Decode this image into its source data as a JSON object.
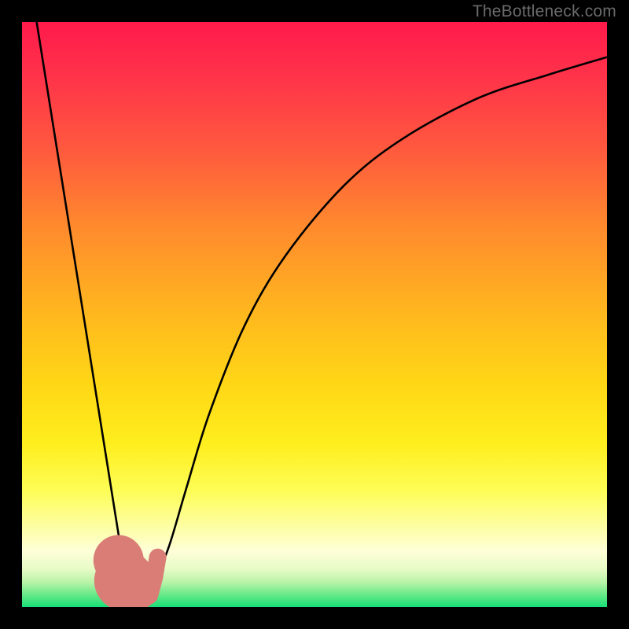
{
  "watermark": "TheBottleneck.com",
  "colors": {
    "black": "#000000",
    "curve": "#000000",
    "dot": "#d97d76"
  },
  "gradient_stops": [
    {
      "offset": 0.0,
      "color": "#ff1a4b"
    },
    {
      "offset": 0.1,
      "color": "#ff3549"
    },
    {
      "offset": 0.22,
      "color": "#ff5a3e"
    },
    {
      "offset": 0.35,
      "color": "#ff8a2d"
    },
    {
      "offset": 0.5,
      "color": "#ffb81e"
    },
    {
      "offset": 0.62,
      "color": "#ffd716"
    },
    {
      "offset": 0.72,
      "color": "#ffee1e"
    },
    {
      "offset": 0.8,
      "color": "#fdfd55"
    },
    {
      "offset": 0.86,
      "color": "#fdfea0"
    },
    {
      "offset": 0.905,
      "color": "#feffd8"
    },
    {
      "offset": 0.935,
      "color": "#e7fbc6"
    },
    {
      "offset": 0.958,
      "color": "#b8f3a8"
    },
    {
      "offset": 0.978,
      "color": "#6be989"
    },
    {
      "offset": 1.0,
      "color": "#17df77"
    }
  ],
  "chart_data": {
    "type": "line",
    "title": "",
    "xlabel": "",
    "ylabel": "",
    "xlim": [
      0,
      100
    ],
    "ylim": [
      0,
      100
    ],
    "grid": false,
    "legend_position": "none",
    "series": [
      {
        "name": "left-descent",
        "values_xy": [
          [
            2.5,
            100
          ],
          [
            18,
            3
          ]
        ]
      },
      {
        "name": "right-curve",
        "values_xy": [
          [
            22,
            3
          ],
          [
            25,
            10
          ],
          [
            28,
            20
          ],
          [
            32,
            33
          ],
          [
            38,
            48
          ],
          [
            45,
            60
          ],
          [
            55,
            72
          ],
          [
            65,
            80
          ],
          [
            78,
            87
          ],
          [
            90,
            91
          ],
          [
            100,
            94
          ]
        ]
      }
    ],
    "points": [
      {
        "name": "dot-upper",
        "x": 16.5,
        "y": 8,
        "r": 1.0
      },
      {
        "name": "dot-mid",
        "x": 17.5,
        "y": 4.5,
        "r": 1.2
      },
      {
        "name": "hook-start",
        "x": 18.2,
        "y": 2.0,
        "r": 1.6
      },
      {
        "name": "hook-bottom",
        "x": 20.0,
        "y": 0.8,
        "r": 1.6
      },
      {
        "name": "hook-up1",
        "x": 21.8,
        "y": 2.0,
        "r": 1.6
      },
      {
        "name": "hook-up2",
        "x": 22.6,
        "y": 5.0,
        "r": 1.6
      },
      {
        "name": "hook-top",
        "x": 23.2,
        "y": 8.5,
        "r": 1.6
      }
    ]
  }
}
